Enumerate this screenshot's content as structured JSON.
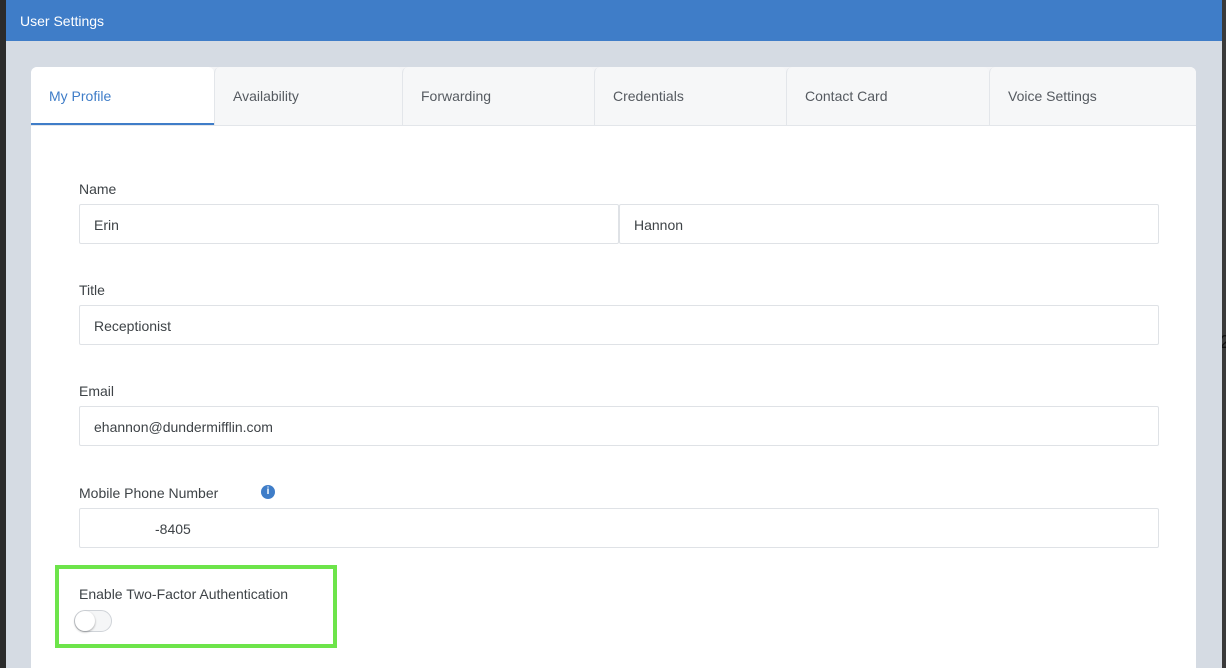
{
  "window": {
    "title": "User Settings"
  },
  "tabs": [
    {
      "label": "My Profile",
      "active": true
    },
    {
      "label": "Availability"
    },
    {
      "label": "Forwarding"
    },
    {
      "label": "Credentials"
    },
    {
      "label": "Contact Card"
    },
    {
      "label": "Voice Settings"
    }
  ],
  "form": {
    "name": {
      "label": "Name",
      "first": "Erin",
      "last": "Hannon"
    },
    "title": {
      "label": "Title",
      "value": "Receptionist"
    },
    "email": {
      "label": "Email",
      "value": "ehannon@dundermifflin.com"
    },
    "mobile": {
      "label": "Mobile Phone Number",
      "value": "-8405",
      "info_icon": "info-icon"
    },
    "two_factor": {
      "label": "Enable Two-Factor Authentication",
      "enabled": false
    }
  },
  "colors": {
    "accent": "#3f7dc8",
    "highlight": "#6de44a"
  }
}
